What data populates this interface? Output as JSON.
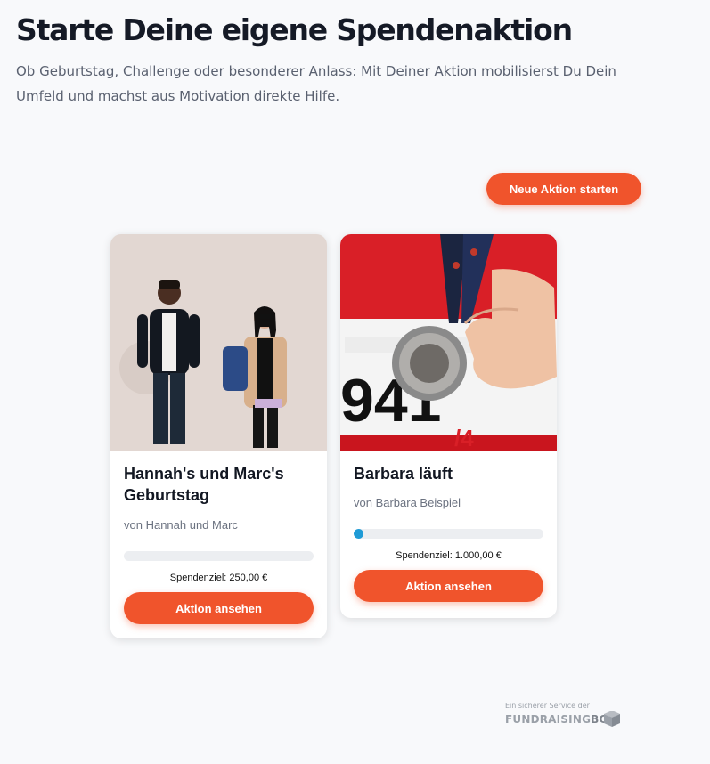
{
  "header": {
    "title": "Starte Deine eigene Spendenaktion",
    "subtitle": "Ob Geburtstag, Challenge oder besonderer Anlass: Mit Deiner Aktion mobilisierst Du Dein Umfeld und machst aus Motivation direkte Hilfe."
  },
  "new_action_button": "Neue Aktion starten",
  "campaigns": [
    {
      "title": "Hannah's und Marc's Geburtstag",
      "by": "von Hannah und Marc",
      "progress": 0,
      "goal_label": "Spendenziel:",
      "goal_amount": "250,00 €",
      "button": "Aktion ansehen",
      "image": "two-people-photo"
    },
    {
      "title": "Barbara läuft",
      "by": "von Barbara Beispiel",
      "progress": 0.05,
      "goal_label": "Spendenziel:",
      "goal_amount": "1.000,00 €",
      "button": "Aktion ansehen",
      "image": "marathon-medal-photo"
    }
  ],
  "footer": {
    "service_text": "Ein sicherer Service der",
    "brand_fund": "FUNDRAISING",
    "brand_box": "BOX",
    "icon": "cube-icon"
  },
  "colors": {
    "accent": "#f0542c",
    "progress": "#1f9bd6"
  }
}
